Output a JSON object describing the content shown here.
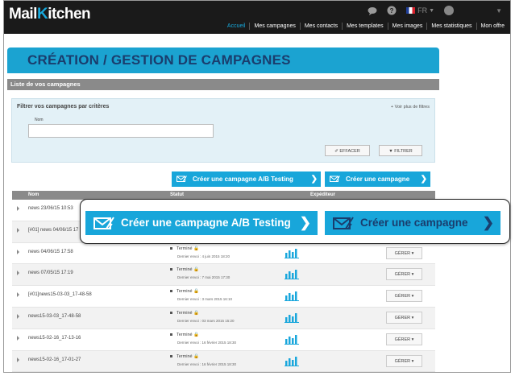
{
  "header": {
    "logo_main": "Mail",
    "logo_k": "K",
    "logo_rest": "itchen",
    "lang": "FR",
    "nav": [
      "Accueil",
      "Mes campagnes",
      "Mes contacts",
      "Mes templates",
      "Mes images",
      "Mes statistiques",
      "Mon offre"
    ]
  },
  "page_title": "CRÉATION / GESTION DE CAMPAGNES",
  "list_header": "Liste de vos campagnes",
  "filter": {
    "title": "Filtrer vos campagnes par critères",
    "more": "+ Voir plus de filtres",
    "name_label": "Nom",
    "name_value": "",
    "clear_label": "EFFACER",
    "filter_label": "FILTRER"
  },
  "actions": {
    "ab_label": "Créer une campagne A/B Testing",
    "create_label": "Créer une campagne"
  },
  "table": {
    "columns": [
      "Nom",
      "Statut",
      "Expéditeur"
    ],
    "manage_label": "GÉRER",
    "rows": [
      {
        "name": "news 23/06/15 10:53",
        "status": "",
        "date": ""
      },
      {
        "name": "[#01] news 04/06/15 17",
        "status": "",
        "date": ""
      },
      {
        "name": "news 04/06/15 17:58",
        "status": "Terminé",
        "date": "Dernier envoi : 4 juin 2015 18:20"
      },
      {
        "name": "news 07/05/15 17:19",
        "status": "Terminé",
        "date": "Dernier envoi : 7 mai 2015 17:30"
      },
      {
        "name": "[#01]news15-03-03_17-48-58",
        "status": "Terminé",
        "date": "Dernier envoi : 3 mars 2015 16:10"
      },
      {
        "name": "news15-03-03_17-48-58",
        "status": "Terminé",
        "date": "Dernier envoi : 03 mars 2015 15:20"
      },
      {
        "name": "news15-02-16_17-13-16",
        "status": "Terminé",
        "date": "Dernier envoi : 16 février 2015 18:30"
      },
      {
        "name": "news15-02-16_17-01-27",
        "status": "Terminé",
        "date": "Dernier envoi : 16 février 2015 18:30"
      }
    ]
  },
  "callout": {
    "ab_label": "Créer une campagne A/B Testing",
    "create_label": "Créer une campagne"
  },
  "colors": {
    "accent": "#18a6da",
    "title_dark": "#1a3d6d",
    "topbar": "#1a1a1a"
  }
}
